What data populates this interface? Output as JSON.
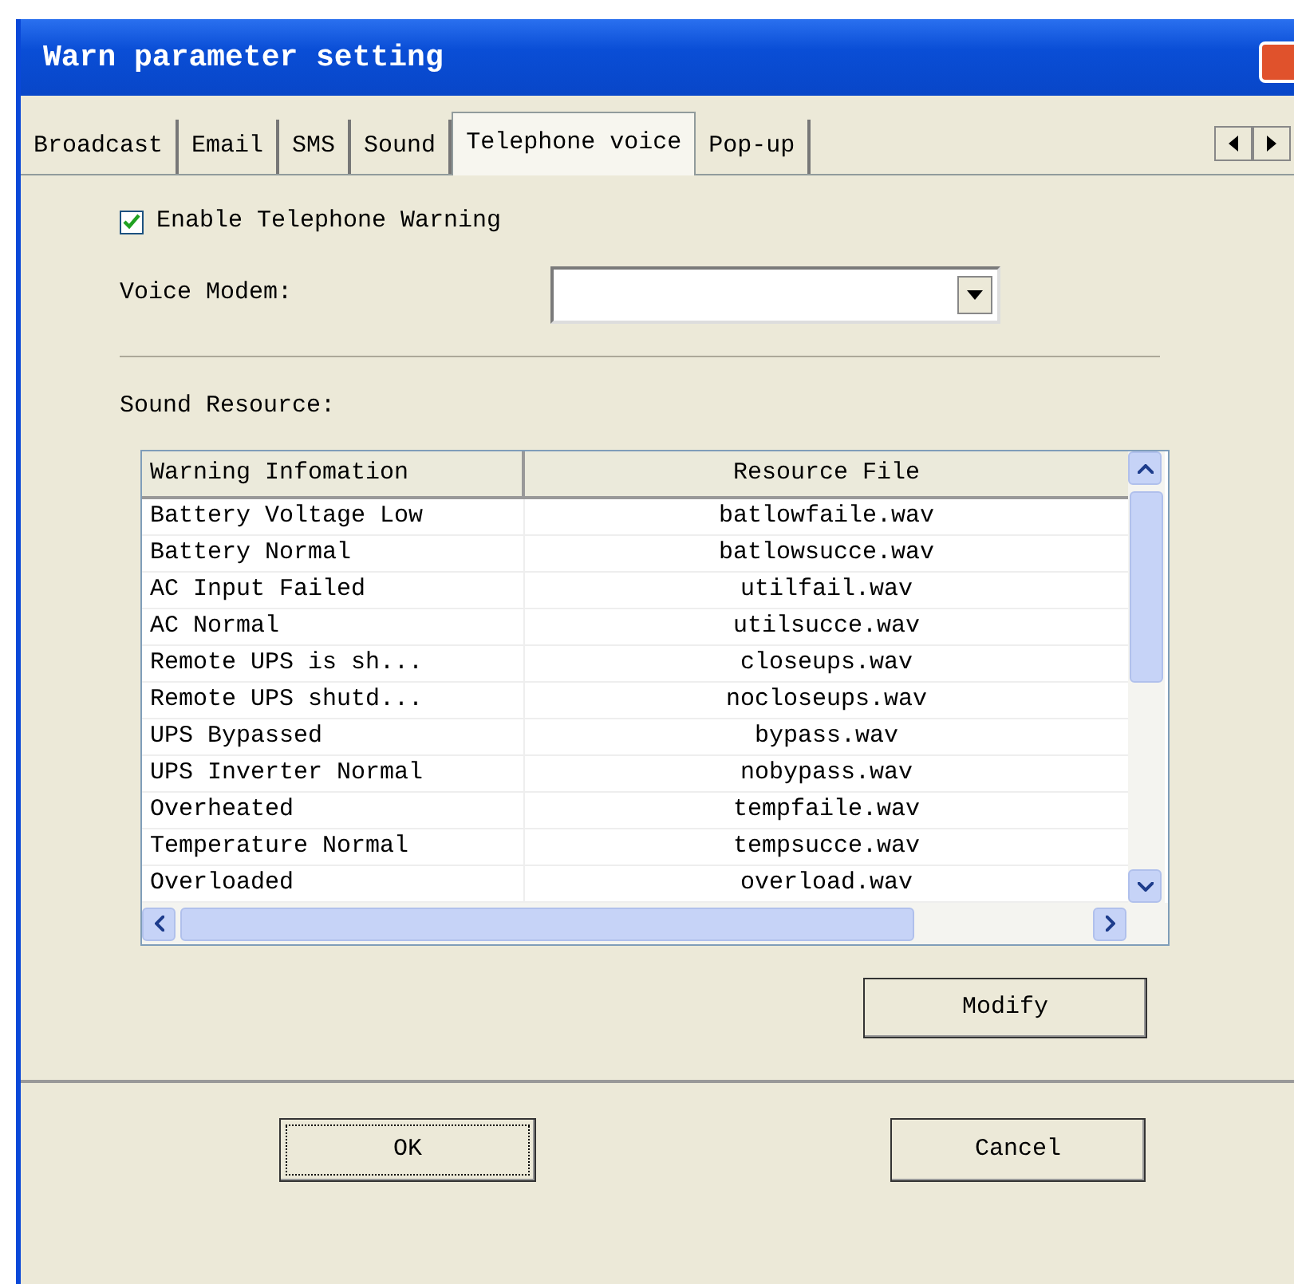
{
  "window": {
    "title": "Warn parameter setting"
  },
  "tabs": [
    {
      "label": "Broadcast",
      "selected": false
    },
    {
      "label": "Email",
      "selected": false
    },
    {
      "label": "SMS",
      "selected": false
    },
    {
      "label": "Sound",
      "selected": false
    },
    {
      "label": "Telephone voice",
      "selected": true
    },
    {
      "label": "Pop-up",
      "selected": false
    }
  ],
  "enable_warning": {
    "label": "Enable Telephone Warning",
    "checked": true
  },
  "voice_modem": {
    "label": "Voice Modem:"
  },
  "sound_resource": {
    "label": "Sound Resource:",
    "columns": [
      "Warning Infomation",
      "Resource File"
    ],
    "rows": [
      [
        "Battery Voltage Low",
        "batlowfaile.wav"
      ],
      [
        "Battery Normal",
        "batlowsucce.wav"
      ],
      [
        "AC Input Failed",
        "utilfail.wav"
      ],
      [
        "AC Normal",
        "utilsucce.wav"
      ],
      [
        "Remote UPS is sh...",
        "closeups.wav"
      ],
      [
        "Remote UPS shutd...",
        "nocloseups.wav"
      ],
      [
        "UPS Bypassed",
        "bypass.wav"
      ],
      [
        "UPS Inverter Normal",
        "nobypass.wav"
      ],
      [
        "Overheated",
        "tempfaile.wav"
      ],
      [
        "Temperature Normal",
        "tempsucce.wav"
      ],
      [
        "Overloaded",
        "overload.wav"
      ]
    ]
  },
  "modify_button": "Modify",
  "buttons": [
    "OK",
    "Cancel"
  ]
}
